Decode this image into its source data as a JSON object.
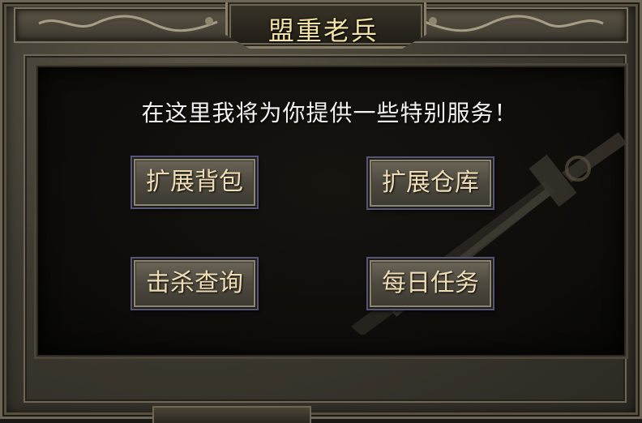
{
  "dialog": {
    "title": "盟重老兵",
    "message": "在这里我将为你提供一些特别服务！",
    "buttons": [
      {
        "label": "扩展背包"
      },
      {
        "label": "扩展仓库"
      },
      {
        "label": "击杀查询"
      },
      {
        "label": "每日任务"
      }
    ]
  },
  "theme": {
    "title_color": "#f3e3a3",
    "button_text_color": "#f1ddb4",
    "panel_color": "#0d0c0a"
  }
}
